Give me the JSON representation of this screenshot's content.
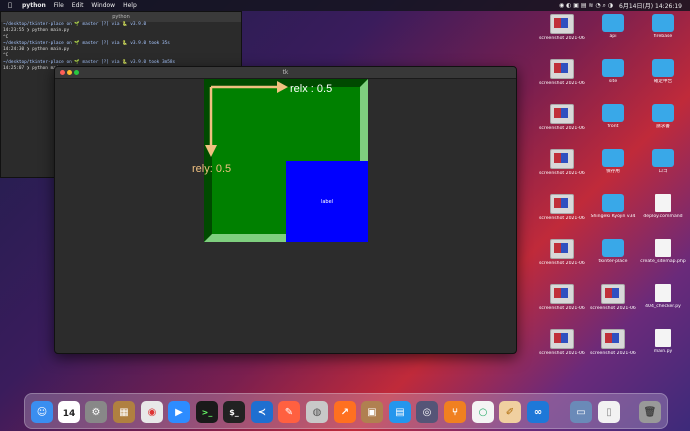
{
  "menubar": {
    "app_name": "python",
    "menus": [
      "File",
      "Edit",
      "Window",
      "Help"
    ],
    "datetime": "6月14日(月) 14:26:19"
  },
  "terminal": {
    "title": "python",
    "lines": [
      "~/desktop/tkinter-place on 🌱 master [?] via 🐍 v3.9.0",
      "14:23:55 ❯ python main.py",
      "^C",
      "~/desktop/tkinter-place on 🌱 master [?] via 🐍 v3.9.0 took 35s",
      "14:24:30 ❯ python main.py",
      "^C",
      "~/desktop/tkinter-place on 🌱 master [?] via 🐍 v3.9.0 took 3m58s",
      "14:25:07 ❯ python main.py"
    ]
  },
  "tk_window": {
    "title": "tk",
    "relx_label": "relx : 0.5",
    "rely_label": "rely: 0.5",
    "blue_label": "label",
    "colors": {
      "frame": "#008000",
      "label_bg": "#0000ff",
      "arrow": "#f0c080"
    }
  },
  "desktop": {
    "col1": [
      "screenshot 2021-06....22.png",
      "screenshot 2021-06....1.57.png",
      "screenshot 2021-06....38.png",
      "screenshot 2021-06....26.png",
      "screenshot 2021-06....28.png",
      "screenshot 2021-06....25.png",
      "screenshot 2021-06....53.png",
      "screenshot 2021-06....08.png"
    ],
    "col2": [
      "api",
      "site",
      "front",
      "保存用",
      "Shingeki Kyojin v34",
      "tkinter-place",
      "screenshot 2021-06....34.png",
      "screenshot 2021-06....48.png"
    ],
    "col3": [
      "firebase",
      "確定申告",
      "請求書",
      "ロゴ",
      "deploy.command",
      "create_sitemap.php",
      "404_checker.py",
      "main.py"
    ]
  },
  "dock": {
    "calendar_day": "14",
    "apps": [
      "finder-icon",
      "calendar-icon",
      "system-preferences-icon",
      "archive-icon",
      "chrome-icon",
      "zoom-icon",
      "terminal-icon",
      "iterm-icon",
      "vscode-icon",
      "safari-icon",
      "disk-utility-icon",
      "activity-icon",
      "package-icon",
      "docker-icon",
      "network-icon",
      "sourcetree-icon",
      "mcafee-icon",
      "notes-icon",
      "infinity-icon",
      "preview-icon",
      "document-icon",
      "trash-icon"
    ]
  }
}
